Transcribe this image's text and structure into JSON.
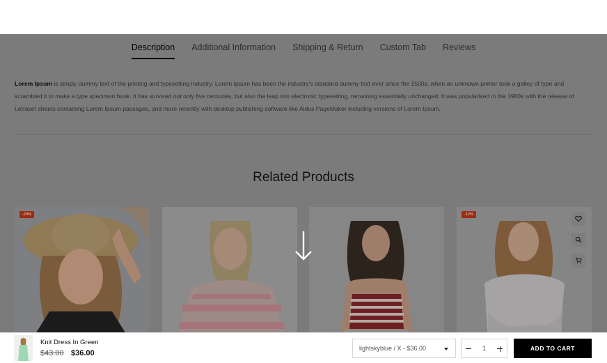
{
  "tabs": [
    {
      "label": "Description",
      "active": true
    },
    {
      "label": "Additional Information",
      "active": false
    },
    {
      "label": "Shipping & Return",
      "active": false
    },
    {
      "label": "Custom Tab",
      "active": false
    },
    {
      "label": "Reviews",
      "active": false
    }
  ],
  "description": {
    "bold_lead": "Lorem Ipsum",
    "body": " is simply dummy text of the printing and typesetting industry. Lorem Ipsum has been the industry's standard dummy text ever since the 1500s, when an unknown printer took a galley of type and scrambled it to make a type specimen book. It has survived not only five centuries, but also the leap into electronic typesetting, remaining essentially unchanged. It was popularised in the 1960s with the release of Letraset sheets containing Lorem Ipsum passages, and more recently with desktop publishing software like Aldus PageMaker including versions of Lorem Ipsum."
  },
  "related": {
    "title": "Related Products",
    "products": [
      {
        "badge": "-20%",
        "icon": "woman-sun-hat-photo"
      },
      {
        "badge": "",
        "icon": "woman-striped-sweater-photo"
      },
      {
        "badge": "",
        "icon": "woman-striped-tank-photo"
      },
      {
        "badge": "-12%",
        "icon": "woman-grey-tee-photo"
      }
    ],
    "quick_icons": [
      "heart-icon",
      "search-icon",
      "cart-icon"
    ]
  },
  "overlay_icon": "arrow-down-icon",
  "sticky_bar": {
    "product_name": "Knit Dress In Green",
    "price_old": "$43.00",
    "price_new": "$36.00",
    "variant": "lightskyblue / X - $36.00",
    "quantity": "1",
    "add_to_cart": "ADD TO CART"
  },
  "colors": {
    "overlay": "#7b7b7b",
    "badge": "#9c2d14",
    "button": "#000000"
  }
}
